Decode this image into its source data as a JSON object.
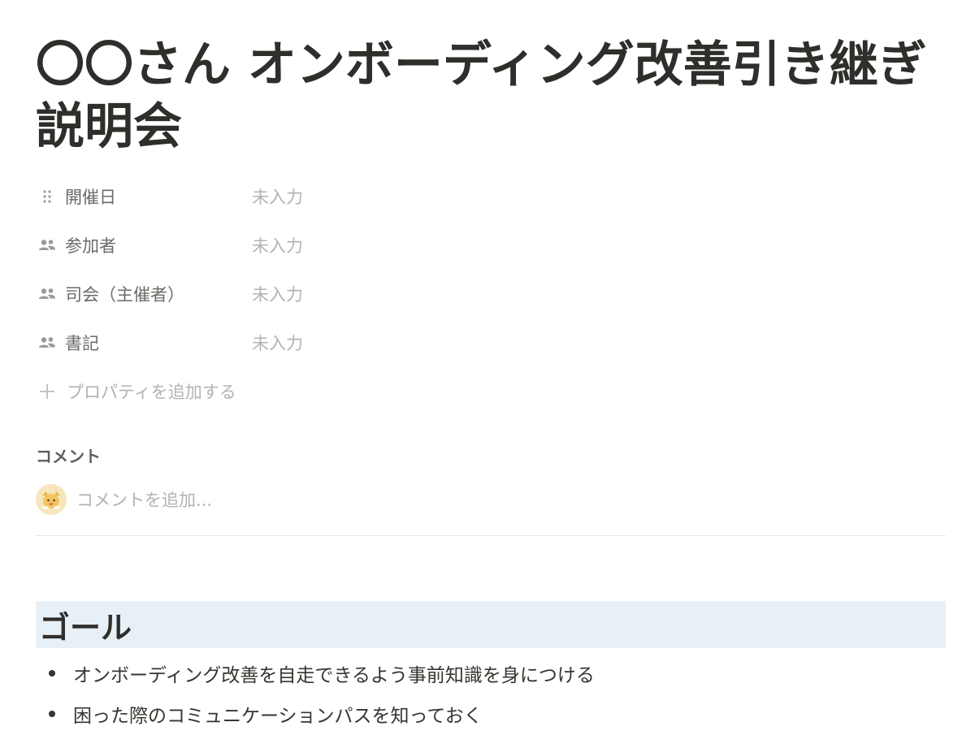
{
  "page": {
    "title": "〇〇さん オンボーディング改善引き継ぎ説明会"
  },
  "properties": [
    {
      "icon": "drag-handle-icon",
      "name": "開催日",
      "value": "未入力"
    },
    {
      "icon": "people-icon",
      "name": "参加者",
      "value": "未入力"
    },
    {
      "icon": "people-icon",
      "name": "司会（主催者）",
      "value": "未入力"
    },
    {
      "icon": "people-icon",
      "name": "書記",
      "value": "未入力"
    }
  ],
  "add_property": {
    "icon": "plus-icon",
    "label": "プロパティを追加する"
  },
  "comments": {
    "label": "コメント",
    "placeholder": "コメントを追加..."
  },
  "section": {
    "heading": "ゴール",
    "bullets": [
      "オンボーディング改善を自走できるよう事前知識を身につける",
      "困った際のコミュニケーションパスを知っておく"
    ]
  },
  "colors": {
    "heading_background": "#e8f0f7",
    "text": "#37352f",
    "muted": "#b4b3af"
  }
}
